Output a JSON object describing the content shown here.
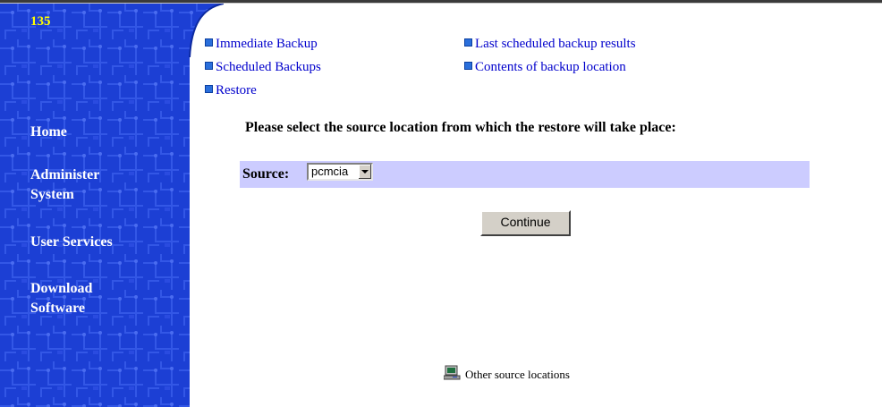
{
  "sidebar": {
    "site_id": "135",
    "items": [
      {
        "label": "Home"
      },
      {
        "label": "Administer System"
      },
      {
        "label": "User Services"
      },
      {
        "label": "Download Software"
      }
    ],
    "background_color": "#1a3fd6"
  },
  "links": {
    "immediate_backup": "Immediate Backup",
    "scheduled_backups": "Scheduled Backups",
    "restore": "Restore",
    "last_scheduled_results": "Last scheduled backup results",
    "contents_backup_location": "Contents of backup location"
  },
  "main": {
    "prompt": "Please select the source location from which the restore will take place:",
    "source_label": "Source:",
    "source_value": "pcmcia",
    "continue_label": "Continue",
    "other_sources_label": "Other source locations"
  },
  "colors": {
    "link": "#0000cc",
    "source_bar": "#ccccff",
    "site_id": "#ffff00"
  }
}
